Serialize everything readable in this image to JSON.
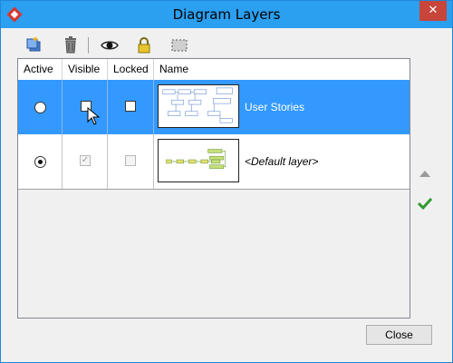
{
  "window": {
    "title": "Diagram Layers",
    "close_glyph": "✕"
  },
  "toolbar": {
    "buttons": [
      {
        "icon": "new-layer-icon"
      },
      {
        "icon": "delete-icon"
      },
      {
        "icon": "eye-icon"
      },
      {
        "icon": "lock-icon"
      },
      {
        "icon": "select-icon"
      }
    ]
  },
  "table": {
    "columns": [
      "Active",
      "Visible",
      "Locked",
      "Name"
    ],
    "rows": [
      {
        "name": "User Stories",
        "active": false,
        "visible": false,
        "locked": false,
        "selected": true
      },
      {
        "name": "<Default layer>",
        "active": true,
        "visible": true,
        "locked": false,
        "disabled_checks": true,
        "selected": false
      }
    ]
  },
  "side_buttons": [
    {
      "icon": "move-up-icon"
    },
    {
      "icon": "apply-check-icon"
    }
  ],
  "footer": {
    "close_label": "Close"
  },
  "colors": {
    "titlebar": "#2b9ff0",
    "selection": "#3399ff",
    "close_x": "#c7453a"
  }
}
